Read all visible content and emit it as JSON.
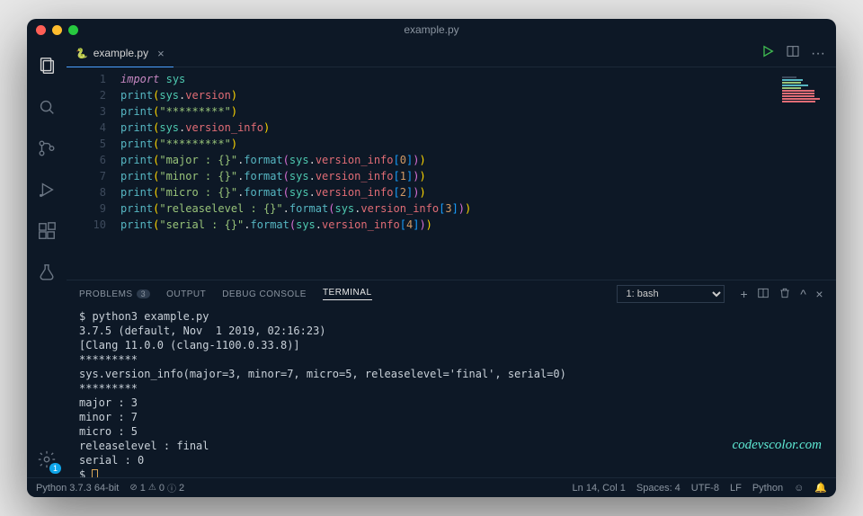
{
  "window": {
    "title": "example.py"
  },
  "tab": {
    "filename": "example.py"
  },
  "code_lines": [
    "import sys",
    "print(sys.version)",
    "print(\"*********\")",
    "print(sys.version_info)",
    "print(\"*********\")",
    "print(\"major : {}\".format(sys.version_info[0]))",
    "print(\"minor : {}\".format(sys.version_info[1]))",
    "print(\"micro : {}\".format(sys.version_info[2]))",
    "print(\"releaselevel : {}\".format(sys.version_info[3]))",
    "print(\"serial : {}\".format(sys.version_info[4]))"
  ],
  "panel": {
    "tabs": {
      "problems": "PROBLEMS",
      "problems_count": "3",
      "output": "OUTPUT",
      "debug": "DEBUG CONSOLE",
      "terminal": "TERMINAL"
    },
    "terminal_select": "1: bash"
  },
  "terminal_lines": [
    "$ python3 example.py",
    "3.7.5 (default, Nov  1 2019, 02:16:23)",
    "[Clang 11.0.0 (clang-1100.0.33.8)]",
    "*********",
    "sys.version_info(major=3, minor=7, micro=5, releaselevel='final', serial=0)",
    "*********",
    "major : 3",
    "minor : 7",
    "micro : 5",
    "releaselevel : final",
    "serial : 0",
    "$ "
  ],
  "statusbar": {
    "python": "Python 3.7.3 64-bit",
    "errors": "1",
    "warnings": "0",
    "infos": "2",
    "cursor": "Ln 14, Col 1",
    "spaces": "Spaces: 4",
    "encoding": "UTF-8",
    "eol": "LF",
    "lang": "Python"
  },
  "watermark": "codevscolor.com"
}
